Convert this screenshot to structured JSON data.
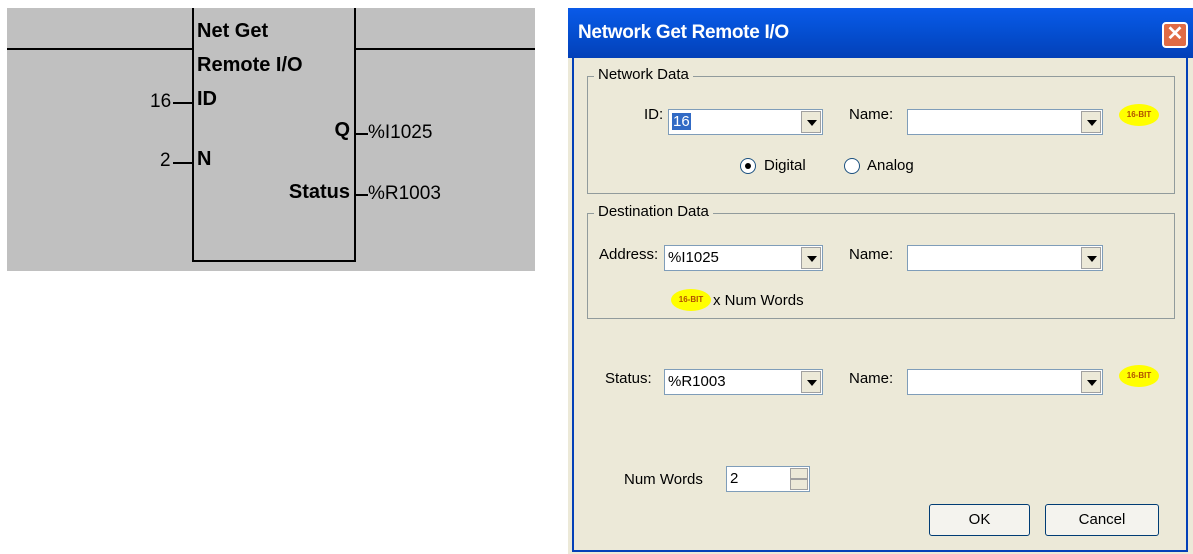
{
  "ladder": {
    "block_title_line1": "Net Get",
    "block_title_line2": "Remote I/O",
    "input_id_label": "ID",
    "input_id_value": "16",
    "input_n_label": "N",
    "input_n_value": "2",
    "output_q_label": "Q",
    "output_q_value": "%I1025",
    "output_status_label": "Status",
    "output_status_value": "%R1003"
  },
  "dialog": {
    "title": "Network Get Remote I/O",
    "close_glyph": "✕",
    "network_data": {
      "group_label": "Network Data",
      "id_label": "ID:",
      "id_value": "16",
      "name_label": "Name:",
      "name_value": "",
      "badge": "16-BIT",
      "radio_digital": "Digital",
      "radio_analog": "Analog",
      "selected_mode": "Digital"
    },
    "destination_data": {
      "group_label": "Destination Data",
      "address_label": "Address:",
      "address_value": "%I1025",
      "name_label": "Name:",
      "name_value": "",
      "badge": "16-BIT",
      "num_words_note": "x Num Words"
    },
    "status": {
      "label": "Status:",
      "value": "%R1003",
      "name_label": "Name:",
      "name_value": "",
      "badge": "16-BIT"
    },
    "num_words": {
      "label": "Num Words",
      "value": "2"
    },
    "ok_label": "OK",
    "cancel_label": "Cancel"
  }
}
